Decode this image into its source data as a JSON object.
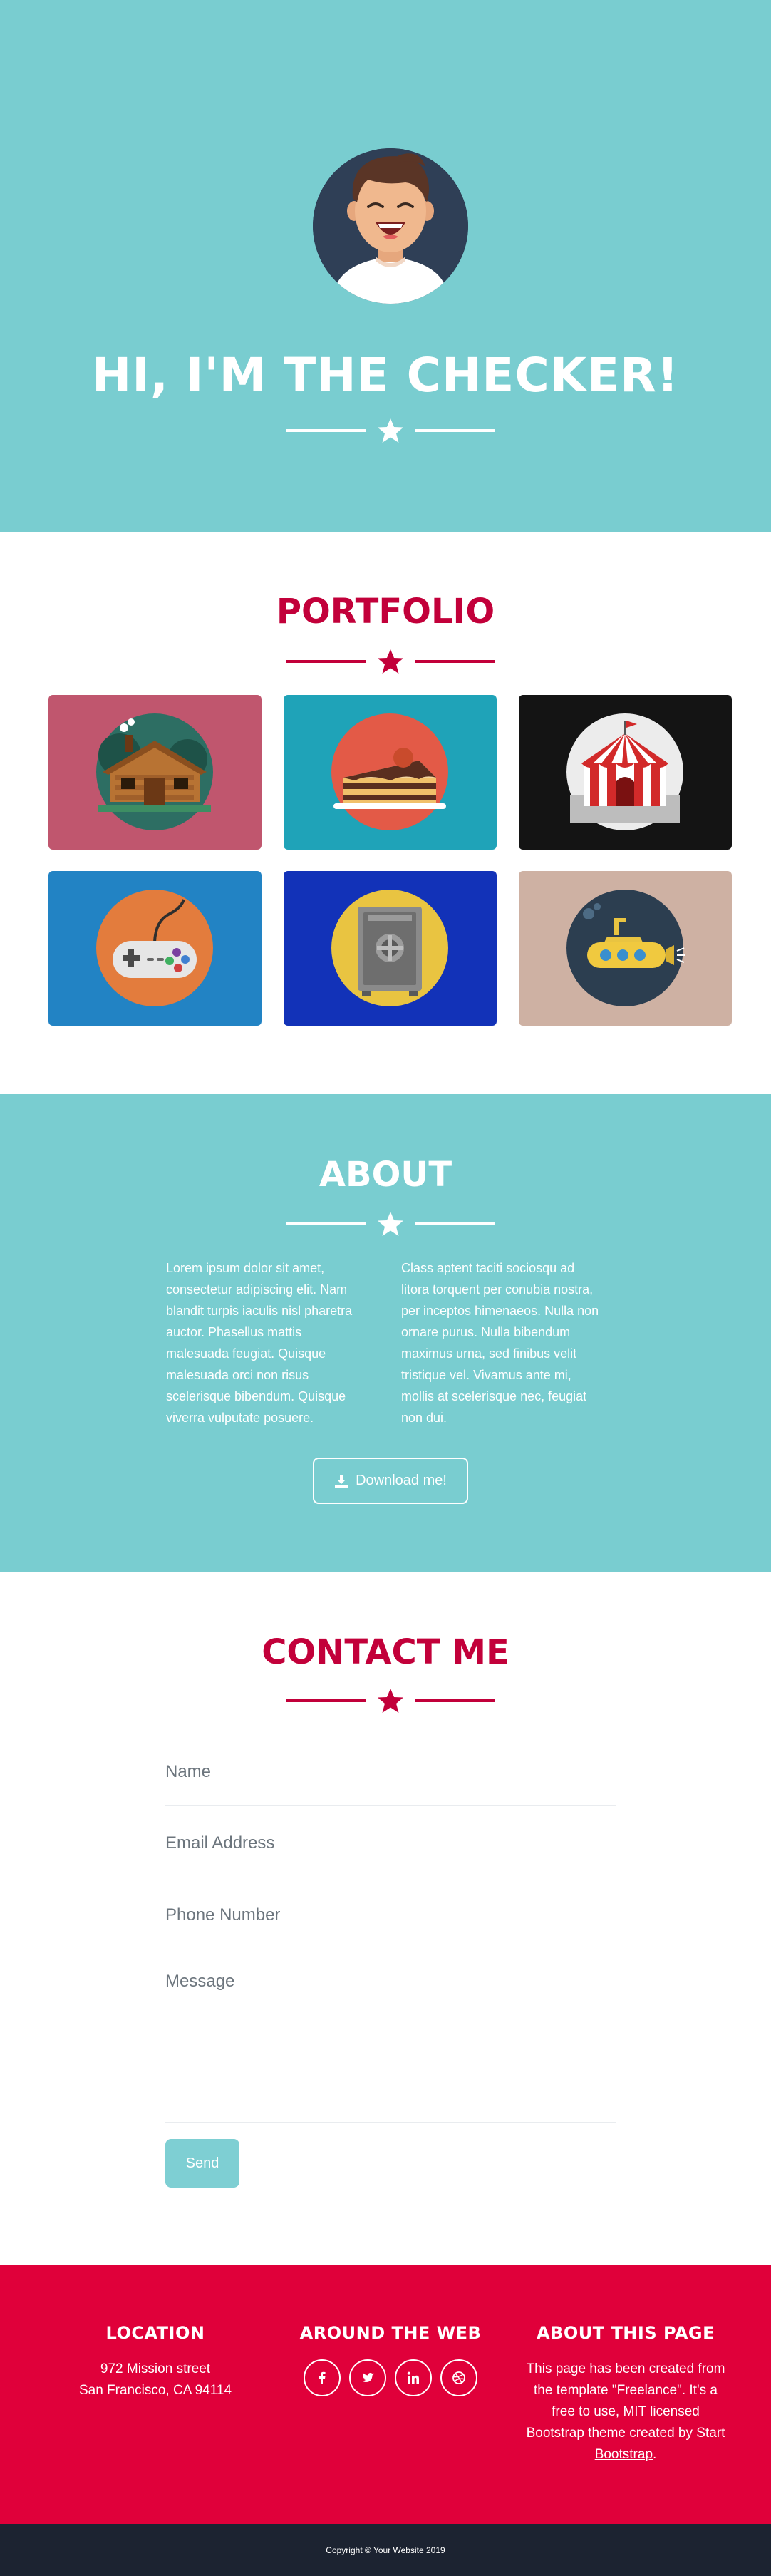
{
  "hero": {
    "title": "HI, I'M THE CHECKER!",
    "avatar_icon": "smiling-man-avatar-icon"
  },
  "portfolio": {
    "title": "PORTFOLIO",
    "items": [
      {
        "icon": "cabin-icon",
        "bg": "#c0566e"
      },
      {
        "icon": "cake-icon",
        "bg": "#1fa3b8"
      },
      {
        "icon": "circus-tent-icon",
        "bg": "#141414"
      },
      {
        "icon": "game-controller-icon",
        "bg": "#2283c4"
      },
      {
        "icon": "safe-icon",
        "bg": "#1232b8"
      },
      {
        "icon": "submarine-icon",
        "bg": "#ceb1a3"
      }
    ]
  },
  "about": {
    "title": "ABOUT",
    "left_lines": [
      "Lorem ipsum dolor sit amet,",
      "consectetur adipiscing elit. Nam",
      "blandit turpis iaculis nisl pharetra",
      "auctor. Phasellus mattis",
      "malesuada feugiat. Quisque",
      "malesuada orci non risus",
      "scelerisque bibendum. Quisque",
      "viverra vulputate posuere."
    ],
    "right_lines": [
      "Class aptent taciti sociosqu ad",
      "litora torquent per conubia nostra,",
      "per inceptos himenaeos. Nulla non",
      "ornare purus. Nulla bibendum",
      "maximus urna, sed finibus velit",
      "tristique vel. Vivamus ante mi,",
      "mollis at scelerisque nec, feugiat",
      "non dui."
    ],
    "download_label": "Download me!",
    "download_icon": "download-icon"
  },
  "contact": {
    "title": "CONTACT ME",
    "name_placeholder": "Name",
    "email_placeholder": "Email Address",
    "phone_placeholder": "Phone Number",
    "message_placeholder": "Message",
    "send_label": "Send"
  },
  "footer": {
    "location_title": "LOCATION",
    "address_line1": "972 Mission street",
    "address_line2": "San Francisco, CA 94114",
    "web_title": "AROUND THE WEB",
    "social": [
      "facebook-icon",
      "twitter-icon",
      "linkedin-icon",
      "dribbble-icon"
    ],
    "about_title": "ABOUT THIS PAGE",
    "about_line1": "This page has been created from",
    "about_line2": "the template \"Freelance\". It's a",
    "about_line3": "free to use, MIT licensed",
    "about_line4_prefix": "Bootstrap theme created by",
    "about_link1": "Start",
    "about_link2": "Bootstrap",
    "about_period": ".",
    "copyright": "Copyright © Your Website 2019"
  },
  "colors": {
    "teal": "#79cdd0",
    "crimson": "#c2003a",
    "footer_red": "#e0003a",
    "dark": "#1c2331"
  }
}
